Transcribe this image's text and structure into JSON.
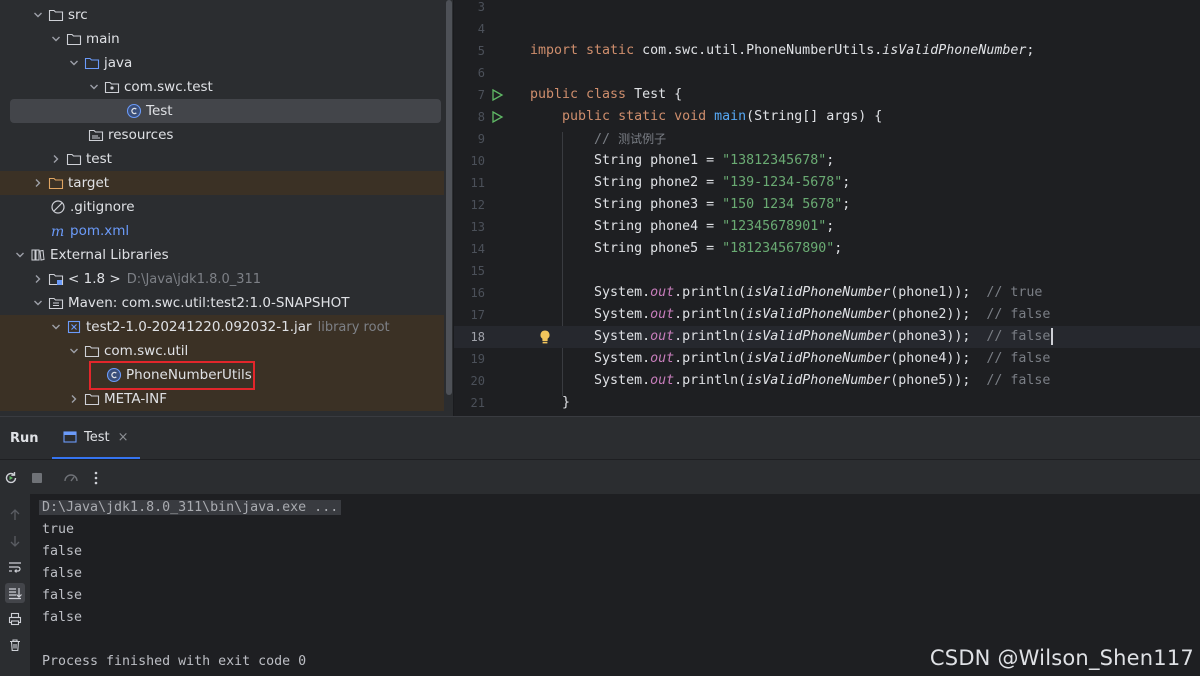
{
  "tree": {
    "items": [
      {
        "label": "src",
        "detail": ""
      },
      {
        "label": "main",
        "detail": ""
      },
      {
        "label": "java",
        "detail": ""
      },
      {
        "label": "com.swc.test",
        "detail": ""
      },
      {
        "label": "Test",
        "detail": ""
      },
      {
        "label": "resources",
        "detail": ""
      },
      {
        "label": "test",
        "detail": ""
      },
      {
        "label": "target",
        "detail": ""
      },
      {
        "label": ".gitignore",
        "detail": ""
      },
      {
        "label": "pom.xml",
        "detail": ""
      },
      {
        "label": "External Libraries",
        "detail": ""
      },
      {
        "label": "< 1.8 >",
        "detail": "D:\\Java\\jdk1.8.0_311"
      },
      {
        "label": "Maven: com.swc.util:test2:1.0-SNAPSHOT",
        "detail": ""
      },
      {
        "label": "test2-1.0-20241220.092032-1.jar",
        "detail": "library root"
      },
      {
        "label": "com.swc.util",
        "detail": ""
      },
      {
        "label": "PhoneNumberUtils",
        "detail": ""
      },
      {
        "label": "META-INF",
        "detail": ""
      }
    ]
  },
  "editor": {
    "lines": [
      {
        "num": "3",
        "text": ""
      },
      {
        "num": "4",
        "text": ""
      },
      {
        "num": "5",
        "text": "import static com.swc.util.PhoneNumberUtils.isValidPhoneNumber;"
      },
      {
        "num": "6",
        "text": ""
      },
      {
        "num": "7",
        "text": "public class Test {"
      },
      {
        "num": "8",
        "text": "    public static void main(String[] args) {"
      },
      {
        "num": "9",
        "text": "        // 测试例子"
      },
      {
        "num": "10",
        "text": "        String phone1 = \"13812345678\";"
      },
      {
        "num": "11",
        "text": "        String phone2 = \"139-1234-5678\";"
      },
      {
        "num": "12",
        "text": "        String phone3 = \"150 1234 5678\";"
      },
      {
        "num": "13",
        "text": "        String phone4 = \"12345678901\";"
      },
      {
        "num": "14",
        "text": "        String phone5 = \"181234567890\";"
      },
      {
        "num": "15",
        "text": ""
      },
      {
        "num": "16",
        "text": "        System.out.println(isValidPhoneNumber(phone1));  // true"
      },
      {
        "num": "17",
        "text": "        System.out.println(isValidPhoneNumber(phone2));  // false"
      },
      {
        "num": "18",
        "text": "        System.out.println(isValidPhoneNumber(phone3));  // false"
      },
      {
        "num": "19",
        "text": "        System.out.println(isValidPhoneNumber(phone4));  // false"
      },
      {
        "num": "20",
        "text": "        System.out.println(isValidPhoneNumber(phone5));  // false"
      },
      {
        "num": "21",
        "text": "    }"
      }
    ]
  },
  "run": {
    "title": "Run",
    "tab_label": "Test",
    "tab_close": "×",
    "console": [
      "D:\\Java\\jdk1.8.0_311\\bin\\java.exe ...",
      "true",
      "false",
      "false",
      "false",
      "false",
      "",
      "Process finished with exit code 0"
    ]
  },
  "watermark": "CSDN @Wilson_Shen117",
  "colors": {
    "accent": "#3574f0",
    "highlight_box": "#e3262b",
    "excluded_bg": "#3b3125",
    "run_green": "#5fb865"
  }
}
